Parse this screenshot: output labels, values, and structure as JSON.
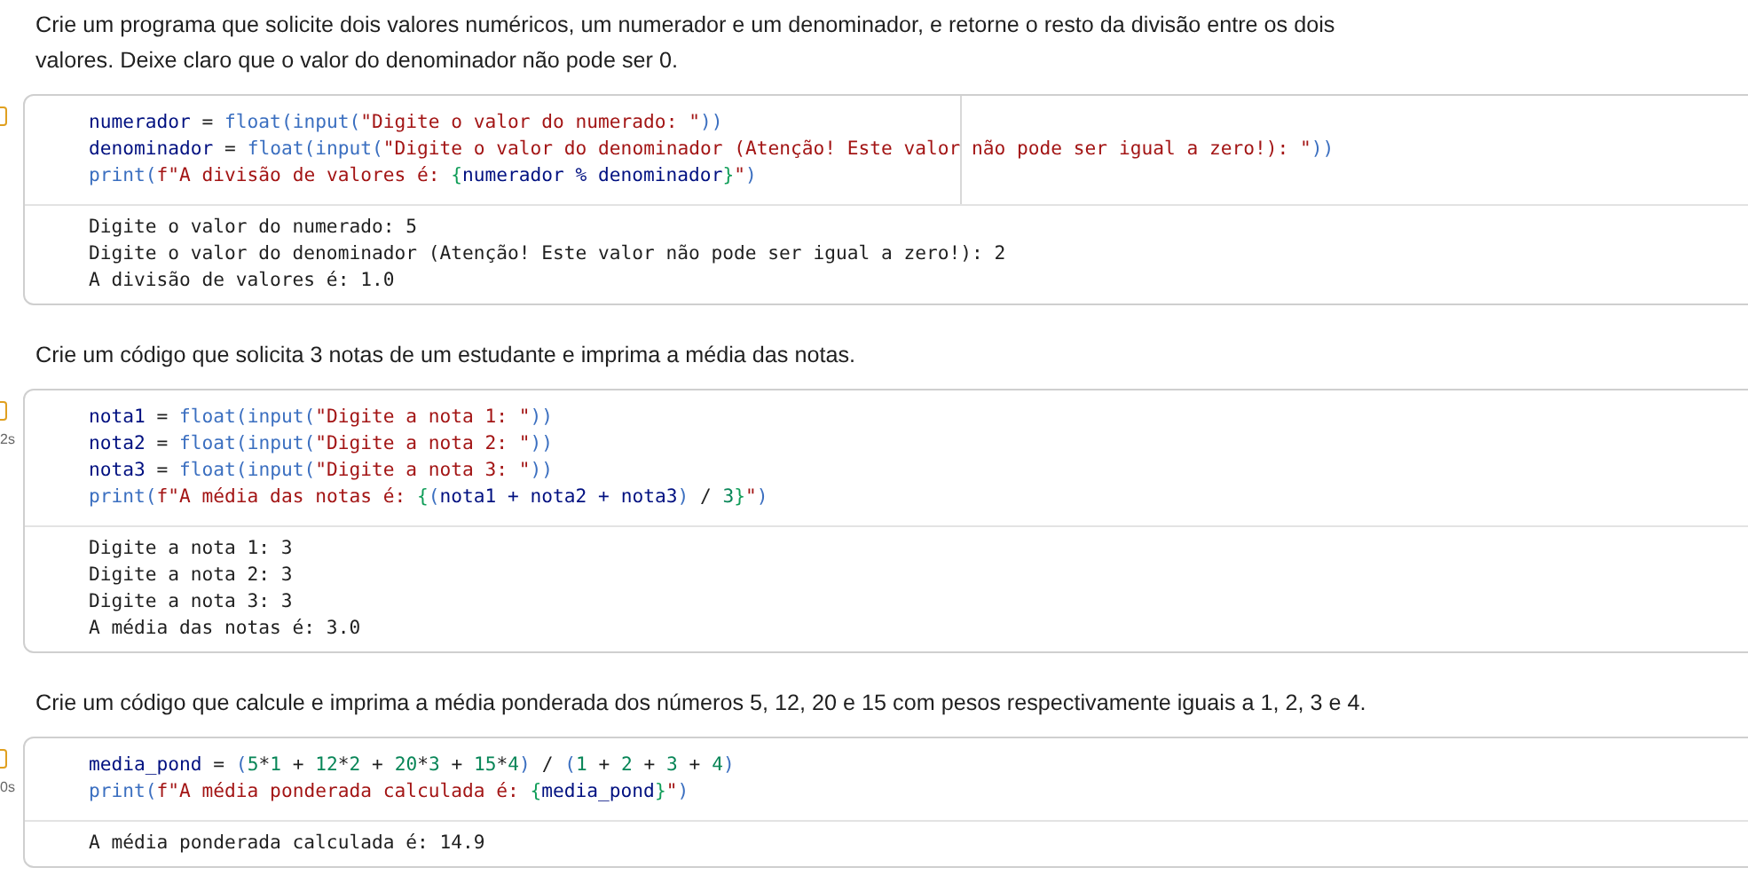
{
  "cells": [
    {
      "kind": "text",
      "text": "Crie um programa que solicite dois valores numéricos, um numerador e um denominador, e retorne o resto da divisão entre os dois valores. Deixe claro que o valor do denominador não pode ser 0."
    },
    {
      "kind": "code",
      "ruler": true,
      "code": [
        [
          {
            "kind": "var",
            "t": "numerador"
          },
          {
            "kind": "op",
            "t": " = "
          },
          {
            "kind": "func",
            "t": "float"
          },
          {
            "kind": "punct",
            "t": "("
          },
          {
            "kind": "func",
            "t": "input"
          },
          {
            "kind": "punct",
            "t": "("
          },
          {
            "kind": "str",
            "t": "\"Digite o valor do numerado: \""
          },
          {
            "kind": "punct",
            "t": "))"
          }
        ],
        [
          {
            "kind": "var",
            "t": "denominador"
          },
          {
            "kind": "op",
            "t": " = "
          },
          {
            "kind": "func",
            "t": "float"
          },
          {
            "kind": "punct",
            "t": "("
          },
          {
            "kind": "func",
            "t": "input"
          },
          {
            "kind": "punct",
            "t": "("
          },
          {
            "kind": "str",
            "t": "\"Digite o valor do denominador (Atenção! Este valor não pode ser igual a zero!): \""
          },
          {
            "kind": "punct",
            "t": "))"
          }
        ],
        [
          {
            "kind": "func",
            "t": "print"
          },
          {
            "kind": "punct",
            "t": "("
          },
          {
            "kind": "str",
            "t": "f\"A divisão de valores é: "
          },
          {
            "kind": "brace",
            "t": "{"
          },
          {
            "kind": "var",
            "t": "numerador % denominador"
          },
          {
            "kind": "brace",
            "t": "}"
          },
          {
            "kind": "str",
            "t": "\""
          },
          {
            "kind": "punct",
            "t": ")"
          }
        ]
      ],
      "output": [
        "Digite o valor do numerado: 5",
        "Digite o valor do denominador (Atenção! Este valor não pode ser igual a zero!): 2",
        "A divisão de valores é: 1.0"
      ]
    },
    {
      "kind": "text",
      "text": "Crie um código que solicita 3 notas de um estudante e imprima a média das notas."
    },
    {
      "kind": "code",
      "ruler": false,
      "time": "2s",
      "code": [
        [
          {
            "kind": "var",
            "t": "nota1"
          },
          {
            "kind": "op",
            "t": " = "
          },
          {
            "kind": "func",
            "t": "float"
          },
          {
            "kind": "punct",
            "t": "("
          },
          {
            "kind": "func",
            "t": "input"
          },
          {
            "kind": "punct",
            "t": "("
          },
          {
            "kind": "str",
            "t": "\"Digite a nota 1: \""
          },
          {
            "kind": "punct",
            "t": "))"
          }
        ],
        [
          {
            "kind": "var",
            "t": "nota2"
          },
          {
            "kind": "op",
            "t": " = "
          },
          {
            "kind": "func",
            "t": "float"
          },
          {
            "kind": "punct",
            "t": "("
          },
          {
            "kind": "func",
            "t": "input"
          },
          {
            "kind": "punct",
            "t": "("
          },
          {
            "kind": "str",
            "t": "\"Digite a nota 2: \""
          },
          {
            "kind": "punct",
            "t": "))"
          }
        ],
        [
          {
            "kind": "var",
            "t": "nota3"
          },
          {
            "kind": "op",
            "t": " = "
          },
          {
            "kind": "func",
            "t": "float"
          },
          {
            "kind": "punct",
            "t": "("
          },
          {
            "kind": "func",
            "t": "input"
          },
          {
            "kind": "punct",
            "t": "("
          },
          {
            "kind": "str",
            "t": "\"Digite a nota 3: \""
          },
          {
            "kind": "punct",
            "t": "))"
          }
        ],
        [
          {
            "kind": "func",
            "t": "print"
          },
          {
            "kind": "punct",
            "t": "("
          },
          {
            "kind": "str",
            "t": "f\"A média das notas é: "
          },
          {
            "kind": "brace",
            "t": "{"
          },
          {
            "kind": "punct",
            "t": "("
          },
          {
            "kind": "var",
            "t": "nota1 + nota2 + nota3"
          },
          {
            "kind": "punct",
            "t": ")"
          },
          {
            "kind": "op",
            "t": " / "
          },
          {
            "kind": "num",
            "t": "3"
          },
          {
            "kind": "brace",
            "t": "}"
          },
          {
            "kind": "str",
            "t": "\""
          },
          {
            "kind": "punct",
            "t": ")"
          }
        ]
      ],
      "output": [
        "Digite a nota 1: 3",
        "Digite a nota 2: 3",
        "Digite a nota 3: 3",
        "A média das notas é: 3.0"
      ]
    },
    {
      "kind": "text",
      "text": "Crie um código que calcule e imprima a média ponderada dos números 5, 12, 20 e 15 com pesos respectivamente iguais a 1, 2, 3 e 4."
    },
    {
      "kind": "code",
      "ruler": false,
      "time": "0s",
      "code": [
        [
          {
            "kind": "var",
            "t": "media_pond"
          },
          {
            "kind": "op",
            "t": " = "
          },
          {
            "kind": "punct",
            "t": "("
          },
          {
            "kind": "num",
            "t": "5"
          },
          {
            "kind": "op",
            "t": "*"
          },
          {
            "kind": "num",
            "t": "1"
          },
          {
            "kind": "op",
            "t": " + "
          },
          {
            "kind": "num",
            "t": "12"
          },
          {
            "kind": "op",
            "t": "*"
          },
          {
            "kind": "num",
            "t": "2"
          },
          {
            "kind": "op",
            "t": " + "
          },
          {
            "kind": "num",
            "t": "20"
          },
          {
            "kind": "op",
            "t": "*"
          },
          {
            "kind": "num",
            "t": "3"
          },
          {
            "kind": "op",
            "t": " + "
          },
          {
            "kind": "num",
            "t": "15"
          },
          {
            "kind": "op",
            "t": "*"
          },
          {
            "kind": "num",
            "t": "4"
          },
          {
            "kind": "punct",
            "t": ")"
          },
          {
            "kind": "op",
            "t": " / "
          },
          {
            "kind": "punct",
            "t": "("
          },
          {
            "kind": "num",
            "t": "1"
          },
          {
            "kind": "op",
            "t": " + "
          },
          {
            "kind": "num",
            "t": "2"
          },
          {
            "kind": "op",
            "t": " + "
          },
          {
            "kind": "num",
            "t": "3"
          },
          {
            "kind": "op",
            "t": " + "
          },
          {
            "kind": "num",
            "t": "4"
          },
          {
            "kind": "punct",
            "t": ")"
          }
        ],
        [
          {
            "kind": "func",
            "t": "print"
          },
          {
            "kind": "punct",
            "t": "("
          },
          {
            "kind": "str",
            "t": "f\"A média ponderada calculada é: "
          },
          {
            "kind": "brace",
            "t": "{"
          },
          {
            "kind": "var",
            "t": "media_pond"
          },
          {
            "kind": "brace",
            "t": "}"
          },
          {
            "kind": "str",
            "t": "\""
          },
          {
            "kind": "punct",
            "t": ")"
          }
        ]
      ],
      "output": [
        "A média ponderada calculada é: 14.9"
      ]
    }
  ]
}
